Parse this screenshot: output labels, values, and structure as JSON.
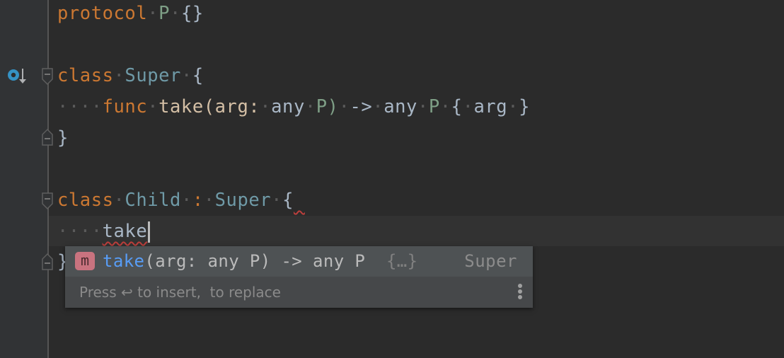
{
  "editor": {
    "lines": [
      {
        "tokens": [
          "protocol",
          "P",
          "{}"
        ]
      },
      {
        "tokens": []
      },
      {
        "tokens": [
          "class",
          "Super",
          "{"
        ]
      },
      {
        "tokens": [
          "func",
          "take",
          "(arg:",
          "any",
          "P)",
          "->",
          "any",
          "P",
          "{",
          "arg",
          "}"
        ]
      },
      {
        "tokens": [
          "}"
        ]
      },
      {
        "tokens": []
      },
      {
        "tokens": [
          "class",
          "Child",
          ":",
          "Super",
          "{"
        ]
      },
      {
        "tokens": [
          "take"
        ]
      },
      {
        "tokens": [
          "}"
        ]
      }
    ],
    "indent_dots": "····",
    "space_dot": "·",
    "gutter_icon": "overridden-method-icon"
  },
  "completion_popup": {
    "badge": "m",
    "item": {
      "name": "take",
      "params": "(arg: any P) -> any P",
      "body_hint": "{…}",
      "owner": "Super"
    },
    "footer": "Press ↩ to insert,  to replace",
    "more_icon": "kebab-menu-icon"
  },
  "colors": {
    "keyword": "#cc7832",
    "type": "#6f9aa7",
    "protocol_type": "#7e9f86",
    "highlight": "#589df6",
    "error_squiggle": "#bc3f3c"
  }
}
